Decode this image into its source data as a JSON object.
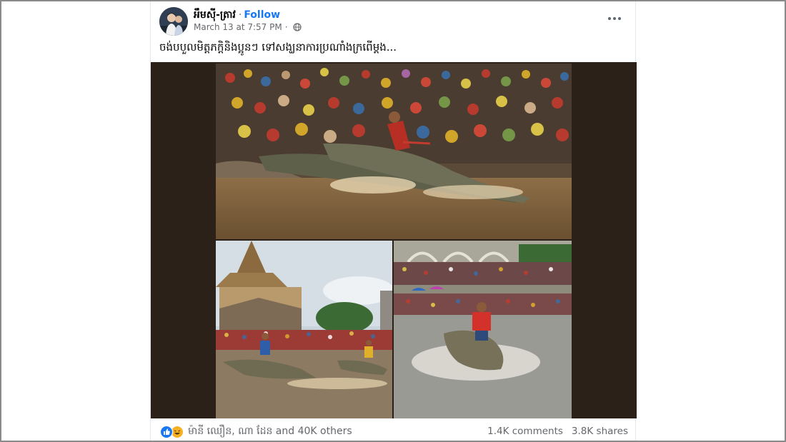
{
  "post": {
    "author": "អឹមស៊ី-ត្រាវ",
    "follow_label": "Follow",
    "separator": "·",
    "timestamp": "March 13 at 7:57 PM",
    "privacy_sep": "·",
    "caption": "ចង់បបួលមិត្តភក្តិនិងប្អូនៗ ទៅសង្ឃនាការប្រណាំងក្រពើម្តង..."
  },
  "footer": {
    "reaction_names": "ម៉ានី ឈឿន, ណា ដែន and 40K others",
    "comments": "1.4K comments",
    "shares": "3.8K shares"
  },
  "icons": {
    "avatar": "profile-avatar",
    "privacy": "globe-icon",
    "more": "more-options-icon",
    "like": "like-reaction-icon",
    "haha": "haha-reaction-icon"
  },
  "colors": {
    "link": "#1877f2",
    "text": "#050505",
    "muted": "#65676b",
    "media_bg": "#2c2118"
  }
}
